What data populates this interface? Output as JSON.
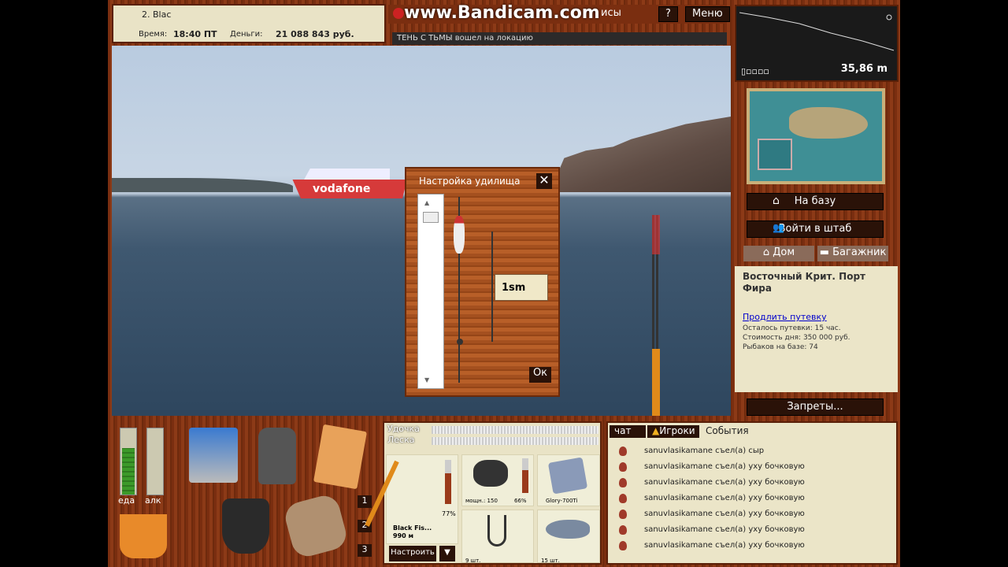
{
  "player": {
    "name": "2. Blac",
    "time_label": "Время:",
    "time": "18:40 ПТ",
    "money_label": "Деньги:",
    "money": "21 088 843 руб."
  },
  "top": {
    "watermark": "www.Bandicam.com",
    "partial_label": "исы",
    "help": "?",
    "menu": "Меню"
  },
  "event_line": "ТЕНЬ С ТЬМЫ вошел на локацию",
  "depth": {
    "value": "35,86 m"
  },
  "right": {
    "to_base": "На базу",
    "enter_hq": "Войти в штаб",
    "home": "Дом",
    "trunk": "Багажник",
    "bans": "Запреты..."
  },
  "location": {
    "name": "Восточный Крит. Порт Фира",
    "extend_link": "Продлить путевку",
    "remaining": "Осталось путевки: 15 час.",
    "cost": "Стоимость дня: 350 000 руб.",
    "anglers": "Рыбаков на базе: 74"
  },
  "dialog": {
    "title": "Настройка удилища",
    "value": "1sm",
    "ok": "Ок",
    "close": "✕"
  },
  "bottom": {
    "food_label": "еда",
    "alc_label": "алк",
    "food_level": 0.7,
    "alc_level": 0.0,
    "slots": [
      "1",
      "2",
      "3"
    ],
    "rod_label": "Удочка",
    "line_label": "Леска",
    "rod_name": "Black Fis...",
    "rod_value": "990 м",
    "rod_pct": "77%",
    "reel_power": "мощн.: 150",
    "reel_pct": "66%",
    "line_name": "Glory-700Ti",
    "hook_count": "9 шт.",
    "bait_count": "15 шт.",
    "configure": "Настроить"
  },
  "chat": {
    "tabs": [
      "чат",
      "Игроки",
      "События"
    ],
    "events": [
      "sanuvlasikamane съел(а) сыр",
      "sanuvlasikamane съел(а) уху бочковую",
      "sanuvlasikamane съел(а) уху бочковую",
      "sanuvlasikamane съел(а) уху бочковую",
      "sanuvlasikamane съел(а) уху бочковую",
      "sanuvlasikamane съел(а) уху бочковую",
      "sanuvlasikamane съел(а) уху бочковую"
    ]
  }
}
